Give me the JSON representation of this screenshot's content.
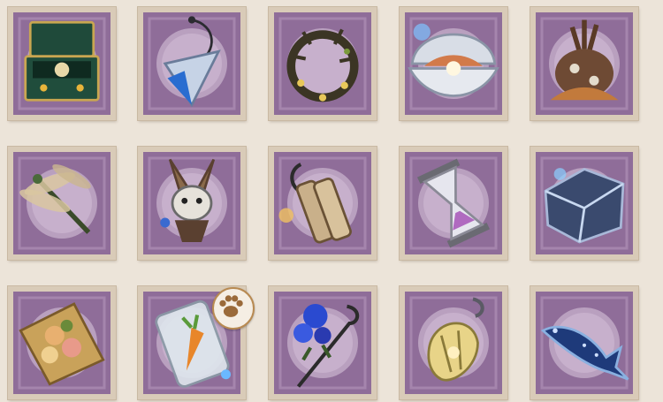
{
  "colors": {
    "background": "#ece4d9",
    "stamp_paper": "#d9cbb8",
    "stamp_frame": "#8f6d99",
    "stamp_pattern": "#a585ad",
    "stamp_center": "#b9a0bf"
  },
  "items": [
    {
      "icon": "music-box-icon"
    },
    {
      "icon": "pendulum-pendant-icon"
    },
    {
      "icon": "thorn-wreath-icon"
    },
    {
      "icon": "pearl-clam-shell-icon"
    },
    {
      "icon": "coral-rock-icon"
    },
    {
      "icon": "dragonfly-icon"
    },
    {
      "icon": "jackalope-rabbit-icon"
    },
    {
      "icon": "dynamite-hook-icon"
    },
    {
      "icon": "hourglass-icon"
    },
    {
      "icon": "crystal-chest-icon"
    },
    {
      "icon": "flower-bouquet-icon"
    },
    {
      "icon": "carrot-jar-icon"
    },
    {
      "icon": "blue-rose-cane-icon"
    },
    {
      "icon": "lantern-pendant-icon"
    },
    {
      "icon": "whale-icon"
    }
  ],
  "badge": {
    "icon": "paw-print-badge-icon"
  }
}
